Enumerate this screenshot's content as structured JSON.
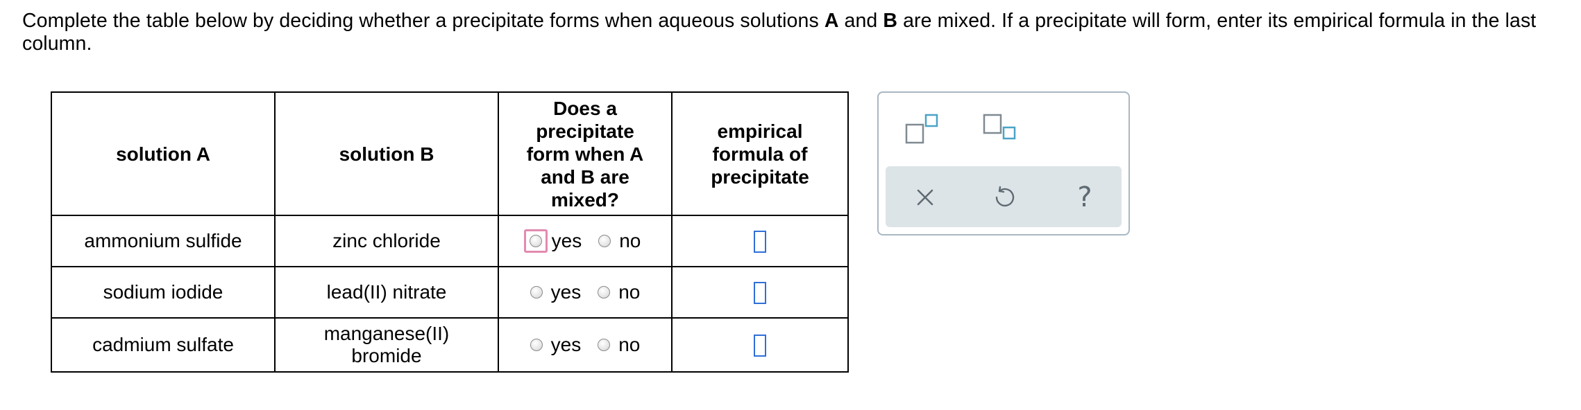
{
  "instructions": {
    "part1": "Complete the table below by deciding whether a precipitate forms when aqueous solutions ",
    "bold_a": "A",
    "part2": " and ",
    "bold_b": "B",
    "part3": " are mixed. If a precipitate will form, enter its empirical formula in the last column."
  },
  "table": {
    "headers": {
      "solution_a": "solution A",
      "solution_b": "solution B",
      "does_precipitate": [
        "Does a",
        "precipitate",
        "form when A",
        "and B are",
        "mixed?"
      ],
      "empirical_formula": [
        "empirical",
        "formula of",
        "precipitate"
      ]
    },
    "rows": [
      {
        "solution_a": "ammonium sulfide",
        "solution_b": [
          "zinc chloride"
        ],
        "yes_label": "yes",
        "no_label": "no"
      },
      {
        "solution_a": "sodium iodide",
        "solution_b": [
          "lead(II) nitrate"
        ],
        "yes_label": "yes",
        "no_label": "no"
      },
      {
        "solution_a": "cadmium sulfate",
        "solution_b": [
          "manganese(II)",
          "bromide"
        ],
        "yes_label": "yes",
        "no_label": "no"
      }
    ]
  },
  "palette": {
    "tools": [
      "superscript-icon",
      "subscript-icon"
    ],
    "actions": [
      "close-icon",
      "undo-icon",
      "help-icon"
    ],
    "help_glyph": "?",
    "accent_color": "#4aa3c8",
    "icon_gray": "#7f8a91"
  },
  "colors": {
    "focus_ring": "#e28ab0",
    "answer_box_border": "#2f6fd8",
    "palette_border": "#a9b7c2",
    "palette_action_bg": "#dde4e8"
  }
}
